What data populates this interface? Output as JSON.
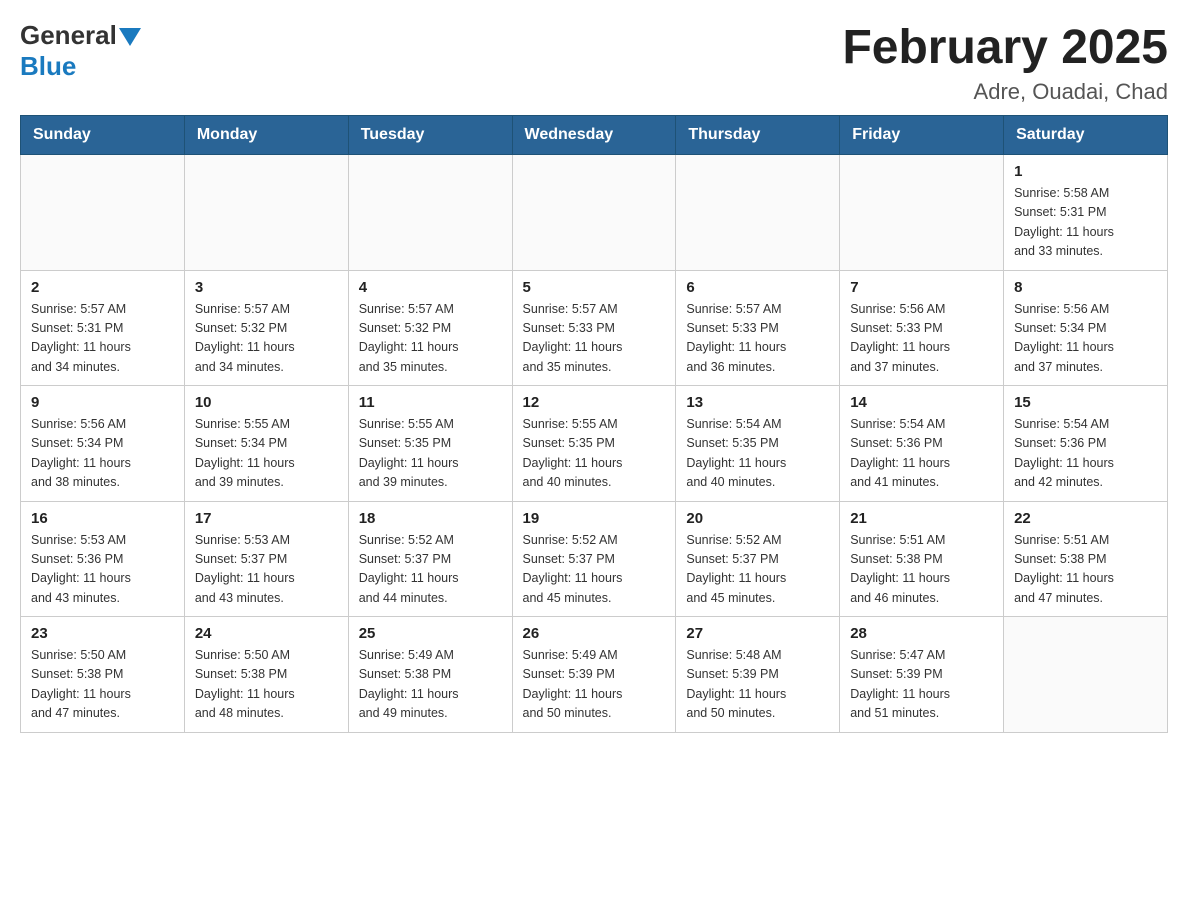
{
  "header": {
    "logo": {
      "general": "General",
      "blue": "Blue",
      "arrow": "▼"
    },
    "title": "February 2025",
    "subtitle": "Adre, Ouadai, Chad"
  },
  "days_of_week": [
    "Sunday",
    "Monday",
    "Tuesday",
    "Wednesday",
    "Thursday",
    "Friday",
    "Saturday"
  ],
  "weeks": [
    {
      "cells": [
        {
          "day": "",
          "info": ""
        },
        {
          "day": "",
          "info": ""
        },
        {
          "day": "",
          "info": ""
        },
        {
          "day": "",
          "info": ""
        },
        {
          "day": "",
          "info": ""
        },
        {
          "day": "",
          "info": ""
        },
        {
          "day": "1",
          "info": "Sunrise: 5:58 AM\nSunset: 5:31 PM\nDaylight: 11 hours\nand 33 minutes."
        }
      ]
    },
    {
      "cells": [
        {
          "day": "2",
          "info": "Sunrise: 5:57 AM\nSunset: 5:31 PM\nDaylight: 11 hours\nand 34 minutes."
        },
        {
          "day": "3",
          "info": "Sunrise: 5:57 AM\nSunset: 5:32 PM\nDaylight: 11 hours\nand 34 minutes."
        },
        {
          "day": "4",
          "info": "Sunrise: 5:57 AM\nSunset: 5:32 PM\nDaylight: 11 hours\nand 35 minutes."
        },
        {
          "day": "5",
          "info": "Sunrise: 5:57 AM\nSunset: 5:33 PM\nDaylight: 11 hours\nand 35 minutes."
        },
        {
          "day": "6",
          "info": "Sunrise: 5:57 AM\nSunset: 5:33 PM\nDaylight: 11 hours\nand 36 minutes."
        },
        {
          "day": "7",
          "info": "Sunrise: 5:56 AM\nSunset: 5:33 PM\nDaylight: 11 hours\nand 37 minutes."
        },
        {
          "day": "8",
          "info": "Sunrise: 5:56 AM\nSunset: 5:34 PM\nDaylight: 11 hours\nand 37 minutes."
        }
      ]
    },
    {
      "cells": [
        {
          "day": "9",
          "info": "Sunrise: 5:56 AM\nSunset: 5:34 PM\nDaylight: 11 hours\nand 38 minutes."
        },
        {
          "day": "10",
          "info": "Sunrise: 5:55 AM\nSunset: 5:34 PM\nDaylight: 11 hours\nand 39 minutes."
        },
        {
          "day": "11",
          "info": "Sunrise: 5:55 AM\nSunset: 5:35 PM\nDaylight: 11 hours\nand 39 minutes."
        },
        {
          "day": "12",
          "info": "Sunrise: 5:55 AM\nSunset: 5:35 PM\nDaylight: 11 hours\nand 40 minutes."
        },
        {
          "day": "13",
          "info": "Sunrise: 5:54 AM\nSunset: 5:35 PM\nDaylight: 11 hours\nand 40 minutes."
        },
        {
          "day": "14",
          "info": "Sunrise: 5:54 AM\nSunset: 5:36 PM\nDaylight: 11 hours\nand 41 minutes."
        },
        {
          "day": "15",
          "info": "Sunrise: 5:54 AM\nSunset: 5:36 PM\nDaylight: 11 hours\nand 42 minutes."
        }
      ]
    },
    {
      "cells": [
        {
          "day": "16",
          "info": "Sunrise: 5:53 AM\nSunset: 5:36 PM\nDaylight: 11 hours\nand 43 minutes."
        },
        {
          "day": "17",
          "info": "Sunrise: 5:53 AM\nSunset: 5:37 PM\nDaylight: 11 hours\nand 43 minutes."
        },
        {
          "day": "18",
          "info": "Sunrise: 5:52 AM\nSunset: 5:37 PM\nDaylight: 11 hours\nand 44 minutes."
        },
        {
          "day": "19",
          "info": "Sunrise: 5:52 AM\nSunset: 5:37 PM\nDaylight: 11 hours\nand 45 minutes."
        },
        {
          "day": "20",
          "info": "Sunrise: 5:52 AM\nSunset: 5:37 PM\nDaylight: 11 hours\nand 45 minutes."
        },
        {
          "day": "21",
          "info": "Sunrise: 5:51 AM\nSunset: 5:38 PM\nDaylight: 11 hours\nand 46 minutes."
        },
        {
          "day": "22",
          "info": "Sunrise: 5:51 AM\nSunset: 5:38 PM\nDaylight: 11 hours\nand 47 minutes."
        }
      ]
    },
    {
      "cells": [
        {
          "day": "23",
          "info": "Sunrise: 5:50 AM\nSunset: 5:38 PM\nDaylight: 11 hours\nand 47 minutes."
        },
        {
          "day": "24",
          "info": "Sunrise: 5:50 AM\nSunset: 5:38 PM\nDaylight: 11 hours\nand 48 minutes."
        },
        {
          "day": "25",
          "info": "Sunrise: 5:49 AM\nSunset: 5:38 PM\nDaylight: 11 hours\nand 49 minutes."
        },
        {
          "day": "26",
          "info": "Sunrise: 5:49 AM\nSunset: 5:39 PM\nDaylight: 11 hours\nand 50 minutes."
        },
        {
          "day": "27",
          "info": "Sunrise: 5:48 AM\nSunset: 5:39 PM\nDaylight: 11 hours\nand 50 minutes."
        },
        {
          "day": "28",
          "info": "Sunrise: 5:47 AM\nSunset: 5:39 PM\nDaylight: 11 hours\nand 51 minutes."
        },
        {
          "day": "",
          "info": ""
        }
      ]
    }
  ]
}
